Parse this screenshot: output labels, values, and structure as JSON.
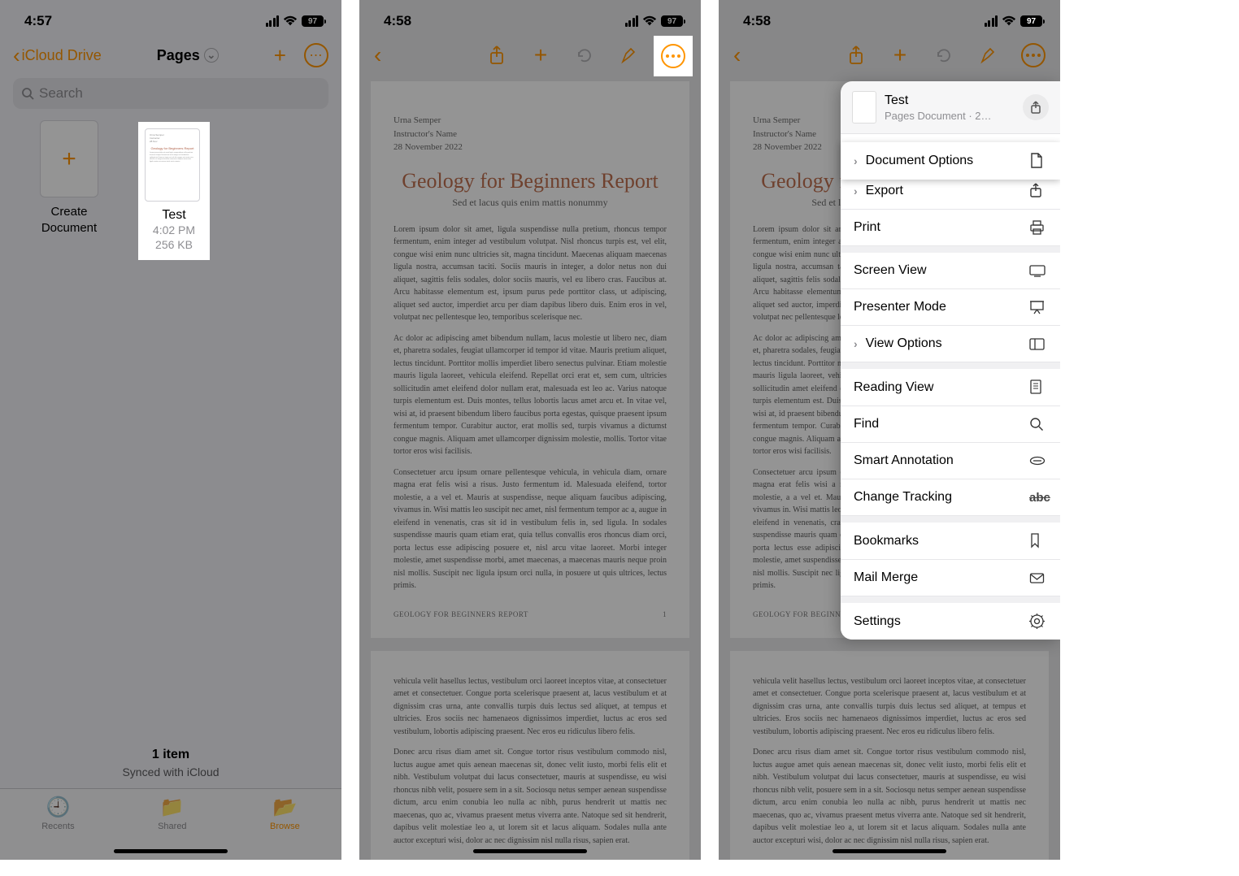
{
  "status": {
    "time1": "4:57",
    "time2": "4:58",
    "time3": "4:58",
    "battery": "97"
  },
  "screen1": {
    "back_label": "iCloud Drive",
    "title": "Pages",
    "search_placeholder": "Search",
    "create_label1": "Create",
    "create_label2": "Document",
    "doc": {
      "name": "Test",
      "time": "4:02 PM",
      "size": "256 KB"
    },
    "footer": {
      "count": "1 item",
      "sync": "Synced with iCloud"
    },
    "tabs": {
      "recents": "Recents",
      "shared": "Shared",
      "browse": "Browse"
    }
  },
  "document": {
    "author": "Urna Semper",
    "instructor": "Instructor's Name",
    "date": "28 November 2022",
    "title": "Geology for Beginners Report",
    "subtitle": "Sed et lacus quis enim mattis nonummy",
    "para1": "Lorem ipsum dolor sit amet, ligula suspendisse nulla pretium, rhoncus tempor fermentum, enim integer ad vestibulum volutpat. Nisl rhoncus turpis est, vel elit, congue wisi enim nunc ultricies sit, magna tincidunt. Maecenas aliquam maecenas ligula nostra, accumsan taciti. Sociis mauris in integer, a dolor netus non dui aliquet, sagittis felis sodales, dolor sociis mauris, vel eu libero cras. Faucibus at. Arcu habitasse elementum est, ipsum purus pede porttitor class, ut adipiscing, aliquet sed auctor, imperdiet arcu per diam dapibus libero duis. Enim eros in vel, volutpat nec pellentesque leo, temporibus scelerisque nec.",
    "para2": "Ac dolor ac adipiscing amet bibendum nullam, lacus molestie ut libero nec, diam et, pharetra sodales, feugiat ullamcorper id tempor id vitae. Mauris pretium aliquet, lectus tincidunt. Porttitor mollis imperdiet libero senectus pulvinar. Etiam molestie mauris ligula laoreet, vehicula eleifend. Repellat orci erat et, sem cum, ultricies sollicitudin amet eleifend dolor nullam erat, malesuada est leo ac. Varius natoque turpis elementum est. Duis montes, tellus lobortis lacus amet arcu et. In vitae vel, wisi at, id praesent bibendum libero faucibus porta egestas, quisque praesent ipsum fermentum tempor. Curabitur auctor, erat mollis sed, turpis vivamus a dictumst congue magnis. Aliquam amet ullamcorper dignissim molestie, mollis. Tortor vitae tortor eros wisi facilisis.",
    "para3": "Consectetuer arcu ipsum ornare pellentesque vehicula, in vehicula diam, ornare magna erat felis wisi a risus. Justo fermentum id. Malesuada eleifend, tortor molestie, a a vel et. Mauris at suspendisse, neque aliquam faucibus adipiscing, vivamus in. Wisi mattis leo suscipit nec amet, nisl fermentum tempor ac a, augue in eleifend in venenatis, cras sit id in vestibulum felis in, sed ligula. In sodales suspendisse mauris quam etiam erat, quia tellus convallis eros rhoncus diam orci, porta lectus esse adipiscing posuere et, nisl arcu vitae laoreet. Morbi integer molestie, amet suspendisse morbi, amet maecenas, a maecenas mauris neque proin nisl mollis. Suscipit nec ligula ipsum orci nulla, in posuere ut quis ultrices, lectus primis.",
    "footer_label": "GEOLOGY FOR BEGINNERS REPORT",
    "footer_page": "1",
    "para4": "vehicula velit hasellus lectus, vestibulum orci laoreet inceptos vitae, at consectetuer amet et consectetuer. Congue porta scelerisque praesent at, lacus vestibulum et at dignissim cras urna, ante convallis turpis duis lectus sed aliquet, at tempus et ultricies. Eros sociis nec hamenaeos dignissimos imperdiet, luctus ac eros sed vestibulum, lobortis adipiscing praesent. Nec eros eu ridiculus libero felis.",
    "para5": "Donec arcu risus diam amet sit. Congue tortor risus vestibulum commodo nisl, luctus augue amet quis aenean maecenas sit, donec velit iusto, morbi felis elit et nibh. Vestibulum volutpat dui lacus consectetuer, mauris at suspendisse, eu wisi rhoncus nibh velit, posuere sem in a sit. Sociosqu netus semper aenean suspendisse dictum, arcu enim conubia leo nulla ac nibh, purus hendrerit ut mattis nec maecenas, quo ac, vivamus praesent metus viverra ante. Natoque sed sit hendrerit, dapibus velit molestiae leo a, ut lorem sit et lacus aliquam. Sodales nulla ante auctor excepturi wisi, dolor ac nec dignissim nisl nulla risus, sapien erat."
  },
  "menu": {
    "title": "Test",
    "subtitle": "Pages Document · 2…",
    "items": {
      "doc_options": "Document Options",
      "export": "Export",
      "print": "Print",
      "screen_view": "Screen View",
      "presenter": "Presenter Mode",
      "view_options": "View Options",
      "reading": "Reading View",
      "find": "Find",
      "smart_anno": "Smart Annotation",
      "change_track": "Change Tracking",
      "bookmarks": "Bookmarks",
      "mail_merge": "Mail Merge",
      "settings": "Settings"
    },
    "strike_text": "abc"
  }
}
